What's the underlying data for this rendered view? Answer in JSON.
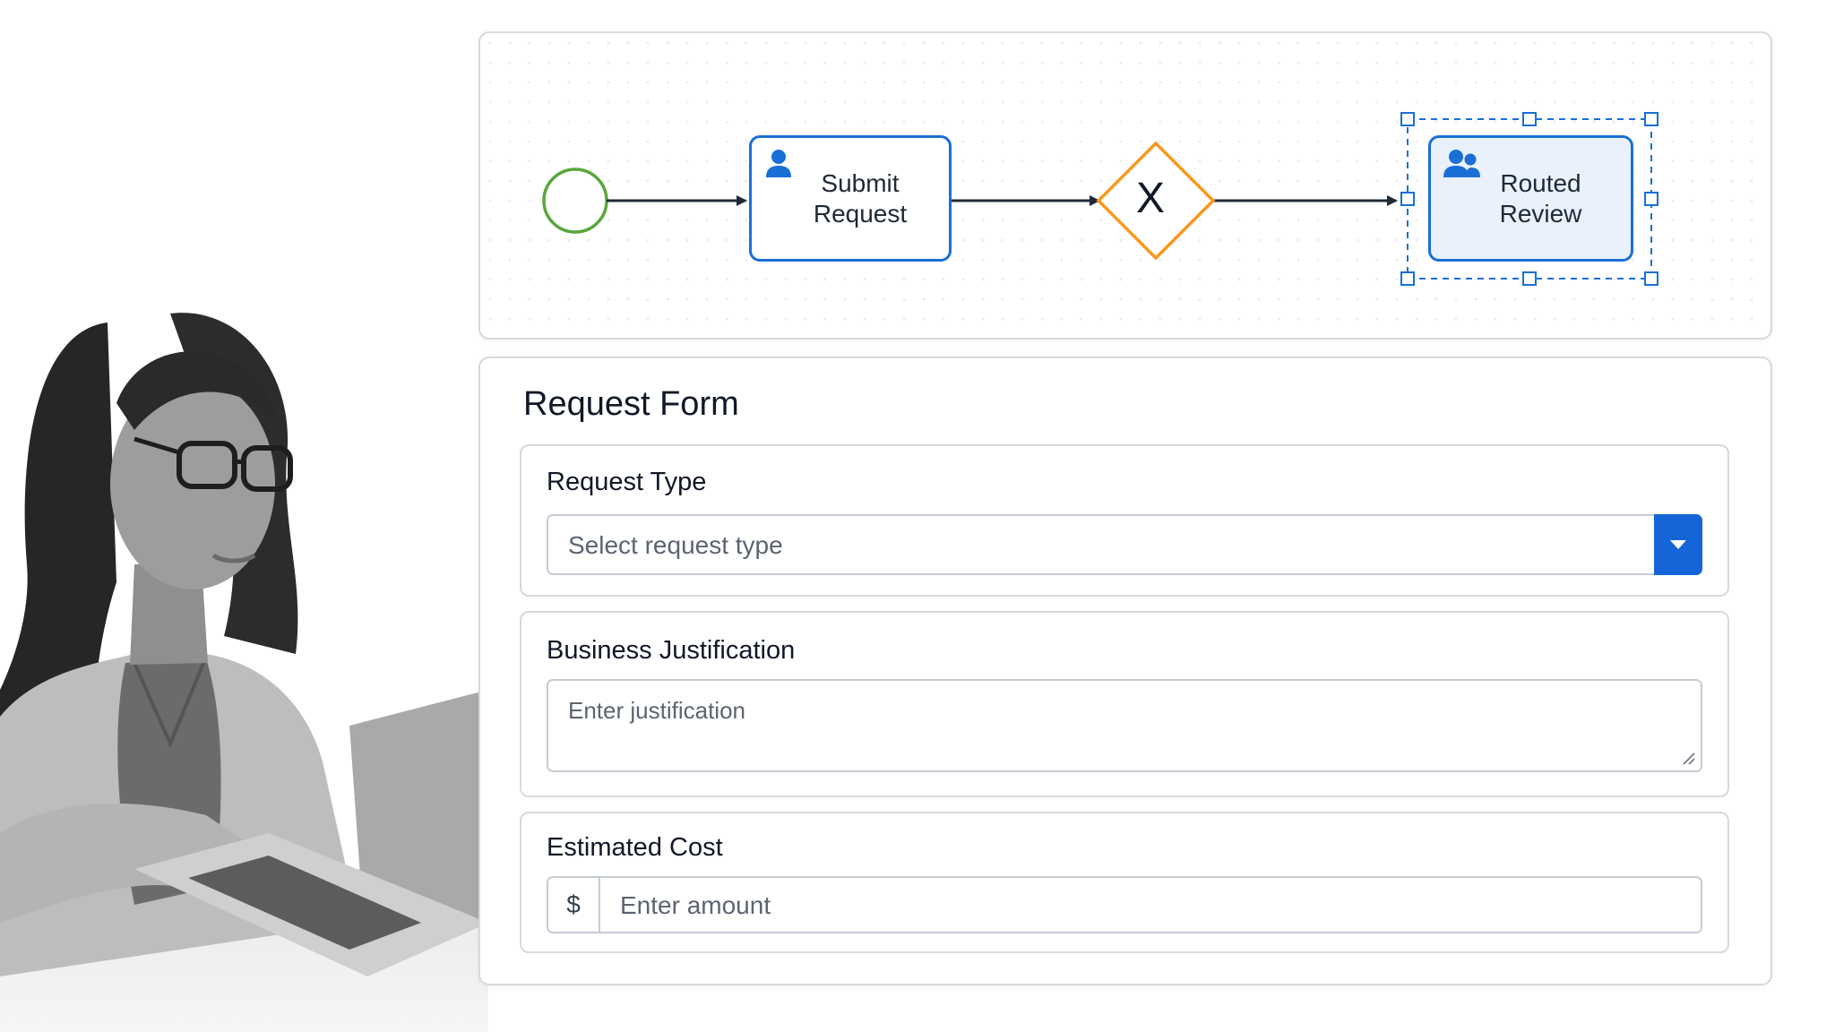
{
  "diagram": {
    "start_event": "start-event",
    "tasks": [
      {
        "label": "Submit\nRequest",
        "icon": "user-icon"
      },
      {
        "label": "Routed\nReview",
        "icon": "users-icon",
        "selected": true
      }
    ],
    "gateway": {
      "label": "X",
      "type": "exclusive-gateway"
    },
    "colors": {
      "start": "#5aa63a",
      "task": "#1a6fd6",
      "gateway": "#f7981d",
      "selection": "#1a6fd6",
      "flow": "#1f2937"
    }
  },
  "form": {
    "title": "Request Form",
    "fields": {
      "request_type": {
        "label": "Request Type",
        "placeholder": "Select request type"
      },
      "justification": {
        "label": "Business Justification",
        "placeholder": "Enter justification"
      },
      "cost": {
        "label": "Estimated Cost",
        "prefix": "$",
        "placeholder": "Enter amount"
      }
    },
    "accent": "#1565d8"
  }
}
